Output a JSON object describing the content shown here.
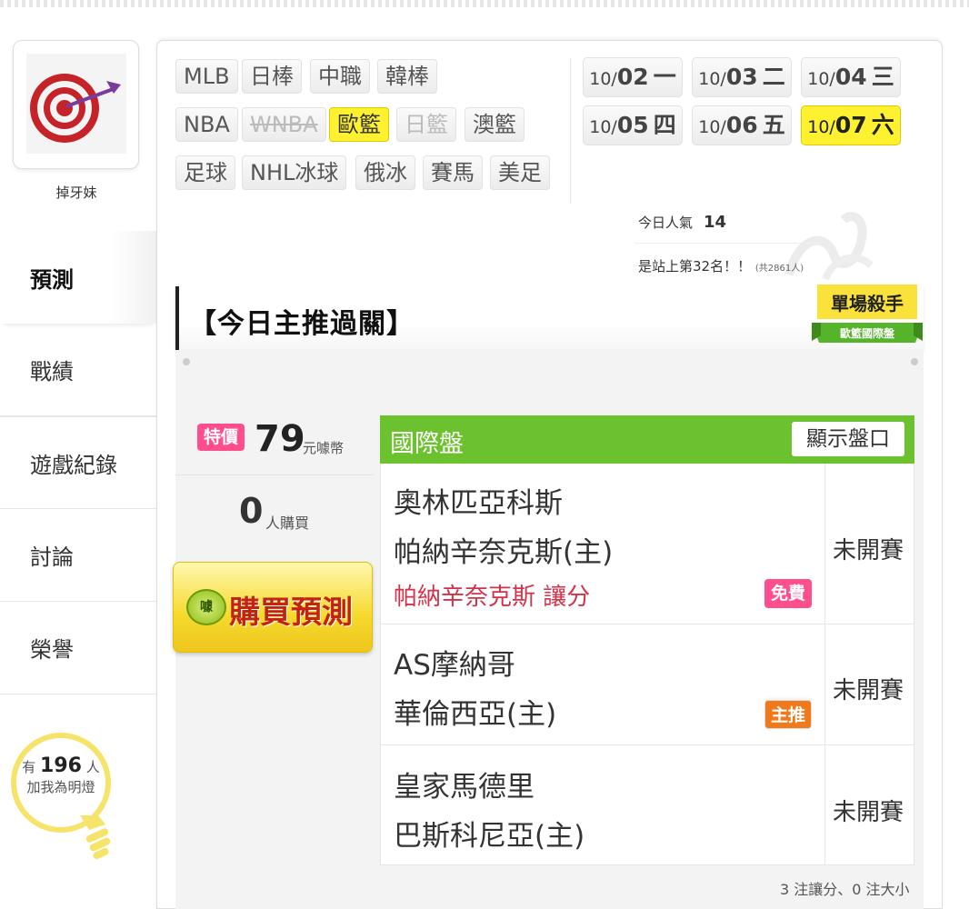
{
  "sidebar": {
    "username": "掉牙妹",
    "nav": [
      {
        "label": "預測",
        "active": true
      },
      {
        "label": "戰績",
        "active": false
      },
      {
        "label": "遊戲紀錄",
        "active": false
      },
      {
        "label": "討論",
        "active": false
      },
      {
        "label": "榮譽",
        "active": false
      }
    ],
    "fans": {
      "prefix": "有",
      "count": "196",
      "suffix": "人",
      "line2": "加我為明燈"
    }
  },
  "sports_tabs": {
    "row1": [
      "MLB",
      "日棒",
      "中職",
      "韓棒"
    ],
    "row2": [
      "NBA",
      "WNBA",
      "歐籃",
      "日籃",
      "澳籃"
    ],
    "row3": [
      "足球",
      "NHL冰球",
      "俄冰",
      "賽馬",
      "美足"
    ],
    "active": "歐籃"
  },
  "dates": [
    {
      "month": "10/",
      "day": "02",
      "weekday": "一",
      "active": false
    },
    {
      "month": "10/",
      "day": "03",
      "weekday": "二",
      "active": false
    },
    {
      "month": "10/",
      "day": "04",
      "weekday": "三",
      "active": false
    },
    {
      "month": "10/",
      "day": "05",
      "weekday": "四",
      "active": false
    },
    {
      "month": "10/",
      "day": "06",
      "weekday": "五",
      "active": false
    },
    {
      "month": "10/",
      "day": "07",
      "weekday": "六",
      "active": true
    }
  ],
  "stats": {
    "popularity_label": "今日人氣",
    "popularity_value": "14",
    "rank_text": "是站上第32名！！",
    "rank_total": "(共2861人)"
  },
  "section": {
    "title": "【今日主推過關】",
    "badge_line1": "單場殺手",
    "badge_line2": "歐籃國際盤"
  },
  "purchase": {
    "special_label": "特價",
    "price": "79",
    "price_unit": "元噱幣",
    "buyers": "0",
    "buyers_unit": "人購買",
    "coin_label": "噱",
    "button_label": "購買預測"
  },
  "games": {
    "header": "國際盤",
    "show_button": "顯示盤口",
    "rows": [
      {
        "away": "奧林匹亞科斯",
        "home": "帕納辛奈克斯(主)",
        "pick": "帕納辛奈克斯 讓分",
        "tag": "免費",
        "status": "未開賽"
      },
      {
        "away": "AS摩納哥",
        "home": "華倫西亞(主)",
        "tag": "主推",
        "status": "未開賽"
      },
      {
        "away": "皇家馬德里",
        "home": "巴斯科尼亞(主)",
        "status": "未開賽"
      }
    ],
    "summary": "3 注讓分、0 注大小"
  },
  "colors": {
    "accent_yellow": "#fef12f",
    "green": "#6cc22e",
    "pink": "#ff4d8d",
    "orange": "#f07a1b",
    "red_text": "#d2334a"
  }
}
